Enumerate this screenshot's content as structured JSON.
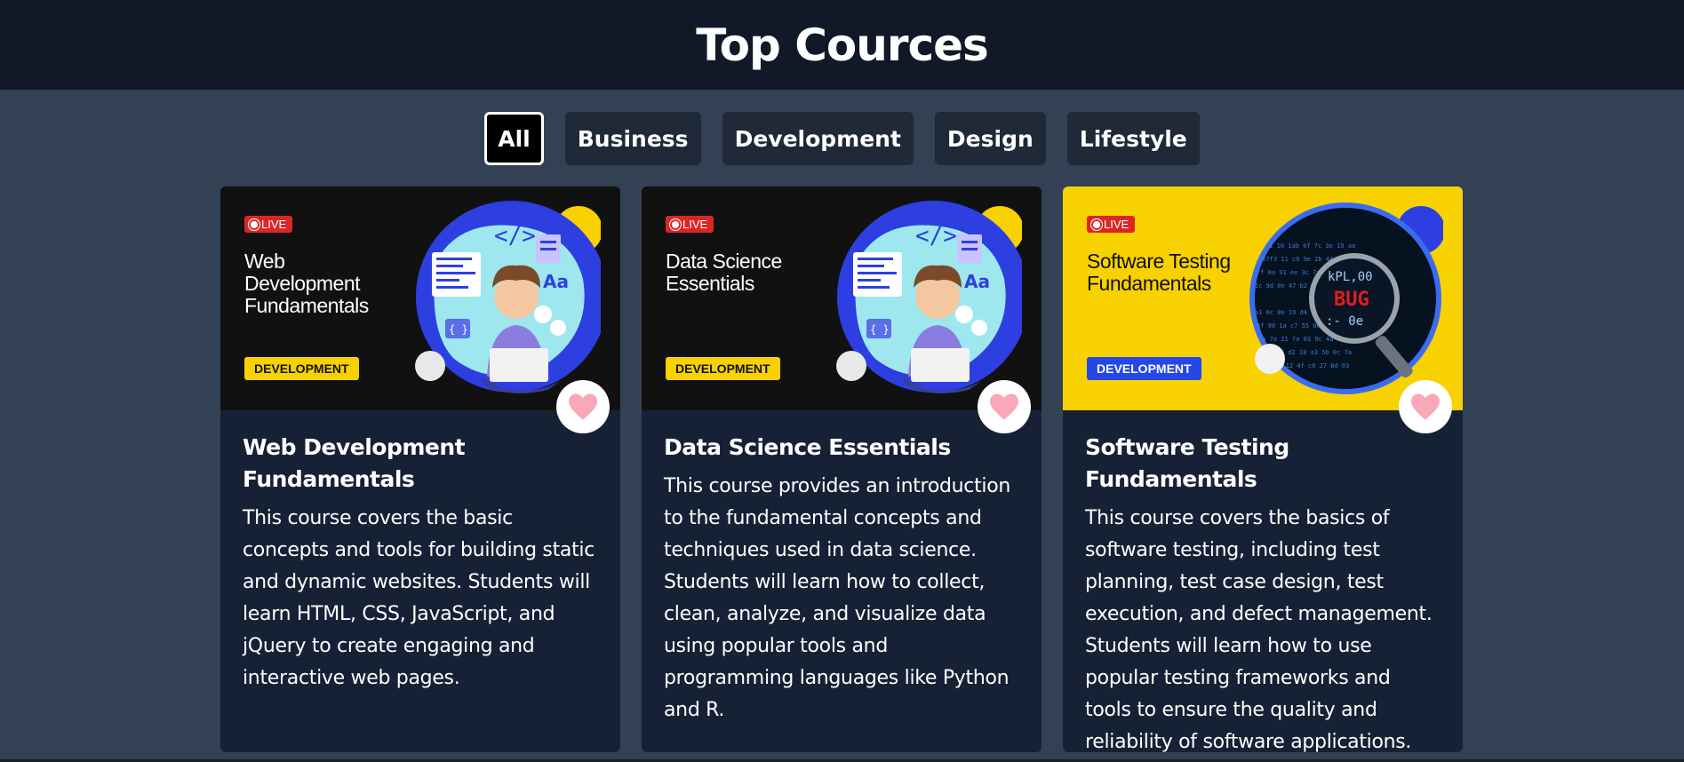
{
  "header": {
    "title": "Top Cources"
  },
  "filters": [
    {
      "label": "All",
      "active": true
    },
    {
      "label": "Business",
      "active": false
    },
    {
      "label": "Development",
      "active": false
    },
    {
      "label": "Design",
      "active": false
    },
    {
      "label": "Lifestyle",
      "active": false
    }
  ],
  "courses": [
    {
      "thumb_live": "LIVE",
      "thumb_title": "Web Development Fundamentals",
      "thumb_tag": "DEVELOPMENT",
      "title": "Web Development Fundamentals",
      "description": "This course covers the basic concepts and tools for building static and dynamic websites. Students will learn HTML, CSS, JavaScript, and jQuery to create engaging and interactive web pages.",
      "illustration": "developer-laptop-illustration",
      "favorite_icon": "heart-icon"
    },
    {
      "thumb_live": "LIVE",
      "thumb_title": "Data Science Essentials",
      "thumb_tag": "DEVELOPMENT",
      "title": "Data Science Essentials",
      "description": "This course provides an introduction to the fundamental concepts and techniques used in data science. Students will learn how to collect, clean, analyze, and visualize data using popular tools and programming languages like Python and R.",
      "illustration": "developer-laptop-illustration",
      "favorite_icon": "heart-icon"
    },
    {
      "thumb_live": "LIVE",
      "thumb_title": "Software Testing Fundamentals",
      "thumb_tag": "DEVELOPMENT",
      "title": "Software Testing Fundamentals",
      "description": "This course covers the basics of software testing, including test planning, test case design, test execution, and defect management. Students will learn how to use popular testing frameworks and tools to ensure the quality and reliability of software applications.",
      "illustration": "magnifier-bug-illustration",
      "bug_text": "BUG",
      "favorite_icon": "heart-icon"
    }
  ],
  "colors": {
    "header_bg": "#111827",
    "page_bg": "#334155",
    "card_bg": "#172135",
    "live_red": "#dc2626",
    "tag_yellow": "#f8d100",
    "tag_blue": "#2547e8",
    "heart_pink": "#f9a8b8"
  }
}
